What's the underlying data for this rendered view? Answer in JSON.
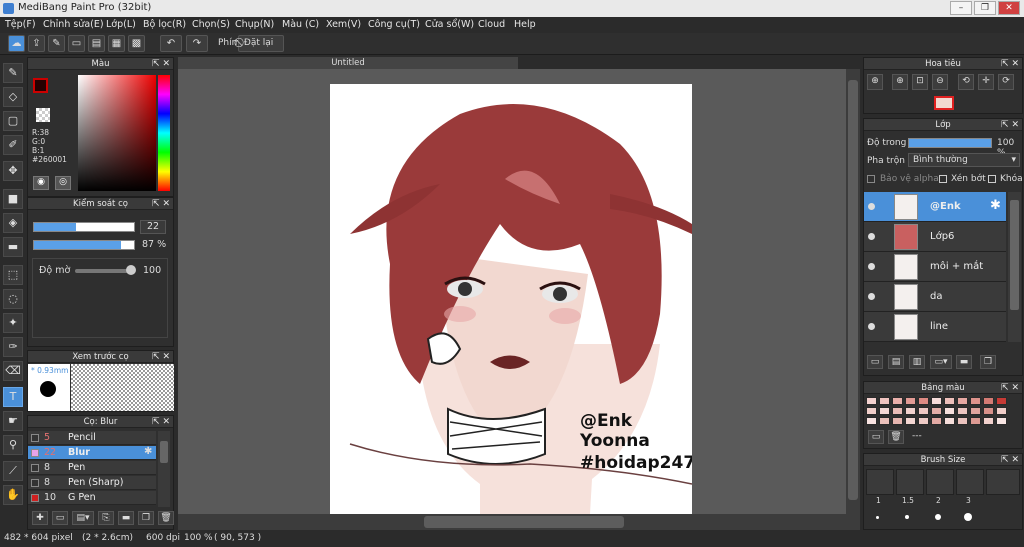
{
  "app": {
    "title": "MediBang Paint Pro (32bit)"
  },
  "menu": [
    "Tệp(F)",
    "Chỉnh sửa(E)",
    "Lớp(L)",
    "Bộ lọc(R)",
    "Chọn(S)",
    "Chụp(N)",
    "Màu (C)",
    "Xem(V)",
    "Công cụ(T)",
    "Cửa sổ(W)",
    "Cloud",
    "Help"
  ],
  "toolbar": {
    "snap_label": "Phím",
    "reset_label": "Đặt lại"
  },
  "document": {
    "tab_title": "Untitled"
  },
  "color_panel": {
    "title": "Màu",
    "r": "R:38",
    "g": "G:0",
    "b": "B:1",
    "hex": "#260001",
    "fg_color": "#260001",
    "bg_color": "#ffffff"
  },
  "brush_control": {
    "title": "Kiểm soát cọ",
    "size": "22",
    "opacity": "87 %",
    "blur_label": "Độ mờ",
    "blur_value": "100"
  },
  "brush_preview": {
    "title": "Xem trước cọ",
    "size_label": "* 0.93mm"
  },
  "brush_list": {
    "title": "Cọ: Blur",
    "items": [
      {
        "size": "5",
        "name": "Pencil",
        "color": "#333333"
      },
      {
        "size": "22",
        "name": "Blur",
        "color": "#e9a3e9"
      },
      {
        "size": "8",
        "name": "Pen",
        "color": "#333333"
      },
      {
        "size": "8",
        "name": "Pen (Sharp)",
        "color": "#333333"
      },
      {
        "size": "10",
        "name": "G Pen",
        "color": "#d02020"
      }
    ]
  },
  "navigator": {
    "title": "Hoa tiêu"
  },
  "layers": {
    "title": "Lớp",
    "opacity_label": "Độ trong",
    "opacity_value": "100 %",
    "opacity_fraction": 1.0,
    "blend_label": "Pha trộn",
    "blend_value": "Bình thường",
    "protect_alpha": "Bảo vệ alpha",
    "clip_label": "Xén bớt",
    "lock_label": "Khóa",
    "items": [
      {
        "name": "@Enk",
        "selected": true
      },
      {
        "name": "Lớp6",
        "selected": false
      },
      {
        "name": "môi + mắt",
        "selected": false
      },
      {
        "name": "da",
        "selected": false
      },
      {
        "name": "line",
        "selected": false
      }
    ]
  },
  "palette": {
    "title": "Bảng màu",
    "dash": "---",
    "colors": [
      "#f4d2cf",
      "#f0c4c0",
      "#eab0ab",
      "#e39b95",
      "#dd8a83",
      "#f6dcd9",
      "#eec0bb",
      "#e6a8a2",
      "#de938c",
      "#d47b74",
      "#c73a35",
      "#f1cfca",
      "#f5d9d6",
      "#e9bcb7",
      "#f3d3cf",
      "#efc8c3",
      "#e4aea8",
      "#f7e0dd",
      "#ecc5c0",
      "#e1a49e",
      "#d8918a",
      "#f0cdc8",
      "#f8e3e1",
      "#eac0ba",
      "#e7b6b0",
      "#f4d7d3",
      "#efcbc6",
      "#e3aaa4",
      "#f6dedb",
      "#ebc3be",
      "#dd9a93",
      "#f2d1cd",
      "#f8e5e3"
    ]
  },
  "brush_size": {
    "title": "Brush Size",
    "labels": [
      "1",
      "1.5",
      "2",
      "3"
    ]
  },
  "canvas_text": {
    "line1": "@Enk",
    "line2": "Yoonna",
    "line3": "#hoidap247"
  },
  "status": {
    "dims": "482 * 604 pixel",
    "cm": "(2 * 2.6cm)",
    "dpi": "600 dpi",
    "zoom": "100 %",
    "coords": "( 90, 573 )"
  }
}
